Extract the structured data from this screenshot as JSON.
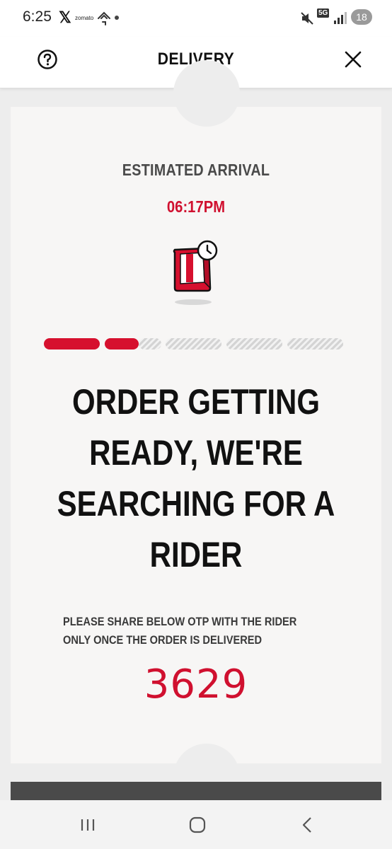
{
  "status_bar": {
    "time": "6:25",
    "x_app_glyph": "𝕏",
    "zomato_label": "zomato",
    "network": "5G",
    "battery": "18",
    "icons": [
      "x-app-icon",
      "zomato-icon",
      "app-icon",
      "notification-dot",
      "mute-icon",
      "5g-icon",
      "signal-icon",
      "battery-icon"
    ]
  },
  "header": {
    "title": "DELIVERY",
    "help_icon": "help-circle-icon",
    "close_icon": "close-icon"
  },
  "ticket": {
    "eta_label": "ESTIMATED ARRIVAL",
    "eta_time": "06:17PM",
    "bag_icon": "food-bag-clock-icon",
    "progress": {
      "total_steps": 5,
      "completed_steps": 2
    },
    "status_heading": "ORDER GETTING READY, WE'RE SEARCHING FOR A RIDER",
    "otp_note": "PLEASE SHARE BELOW OTP WITH THE RIDER ONLY ONCE THE ORDER IS DELIVERED",
    "otp_code": "3629"
  },
  "nav_bar": {
    "recents_icon": "recents-icon",
    "home_icon": "home-icon",
    "back_icon": "back-icon"
  },
  "colors": {
    "accent_red": "#d0102f",
    "text_dark": "#111111",
    "card_bg": "#f7f6f5",
    "page_bg": "#ededed"
  }
}
